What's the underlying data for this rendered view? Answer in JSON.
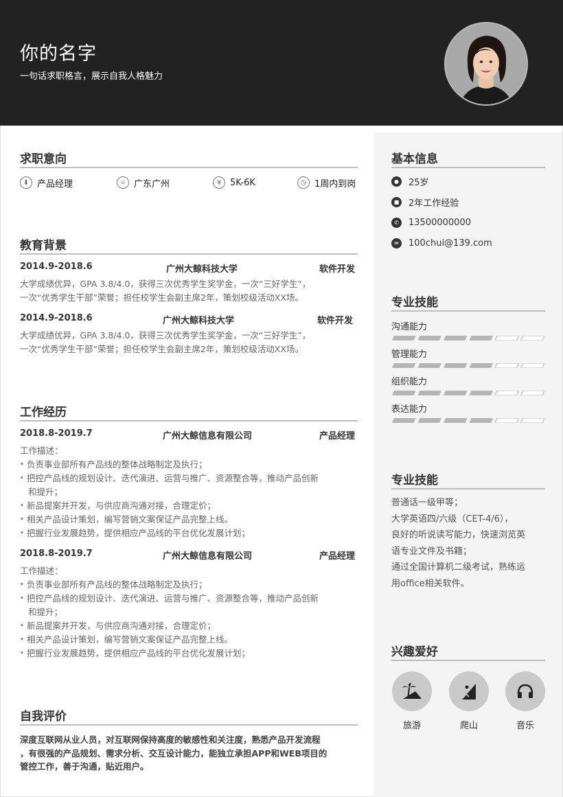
{
  "header": {
    "name": "你的名字",
    "slogan": "一句话求职格言，展示自我人格魅力"
  },
  "intent": {
    "title": "求职意向",
    "items": [
      {
        "icon": "briefcase-icon",
        "text": "产品经理"
      },
      {
        "icon": "location-icon",
        "text": "广东广州"
      },
      {
        "icon": "yen-icon",
        "text": "5K-6K"
      },
      {
        "icon": "clock-icon",
        "text": "1周内到岗"
      }
    ]
  },
  "education": {
    "title": "教育背景",
    "entries": [
      {
        "date": "2014.9-2018.6",
        "school": "广州大鲸科技大学",
        "major": "软件开发",
        "line1": "大学成绩优异，GPA 3.8/4.0，获得三次优秀学生奖学金，一次“三好学生”，",
        "line2": "一次“优秀学生干部”荣誉；担任校学生会副主席2年，策划校级活动XX场。"
      },
      {
        "date": "2014.9-2018.6",
        "school": "广州大鲸科技大学",
        "major": "软件开发",
        "line1": "大学成绩优异，GPA 3.8/4.0，获得三次优秀学生奖学金，一次“三好学生”，",
        "line2": "一次“优秀学生干部”荣誉；担任校学生会副主席2年，策划校级活动XX场。"
      }
    ]
  },
  "work": {
    "title": "工作经历",
    "entries": [
      {
        "date": "2018.8-2019.7",
        "company": "广州大鲸信息有限公司",
        "role": "产品经理",
        "desc_label": "工作描述：",
        "bullets": [
          "负责事业部所有产品线的整体战略制定及执行；",
          "把控产品线的规划设计、迭代演进、运营与推广、资源整合等，推动产品创新",
          "和提升；",
          "新品提案并开发，与供应商沟通对接，合理定价；",
          "相关产品设计策划，编写营销文案保证产品完整上线。",
          "把握行业发展趋势，提供相应产品线的平台优化发展计划；"
        ]
      },
      {
        "date": "2018.8-2019.7",
        "company": "广州大鲸信息有限公司",
        "role": "产品经理",
        "desc_label": "工作描述：",
        "bullets": [
          "负责事业部所有产品线的整体战略制定及执行；",
          "把控产品线的规划设计、迭代演进、运营与推广、资源整合等，推动产品创新",
          "和提升；",
          "新品提案并开发，与供应商沟通对接，合理定价；",
          "相关产品设计策划，编写营销文案保证产品完整上线。",
          "把握行业发展趋势，提供相应产品线的平台优化发展计划；"
        ]
      }
    ]
  },
  "self_eval": {
    "title": "自我评价",
    "lines": [
      "深度互联网从业人员，对互联网保持高度的敏感性和关注度，熟悉产品开发流程",
      "，有很强的产品规划、需求分析、交互设计能力，能独立承担APP和WEB项目的",
      "管控工作，善于沟通，贴近用户。"
    ]
  },
  "basic_info": {
    "title": "基本信息",
    "items": [
      {
        "icon": "age-icon",
        "text": "25岁"
      },
      {
        "icon": "experience-icon",
        "text": "2年工作经验"
      },
      {
        "icon": "phone-icon",
        "text": "13500000000"
      },
      {
        "icon": "email-icon",
        "text": "100chui@139.com"
      }
    ]
  },
  "skills": {
    "title": "专业技能",
    "items": [
      {
        "name": "沟通能力",
        "level": 0.67
      },
      {
        "name": "管理能力",
        "level": 0.67
      },
      {
        "name": "组织能力",
        "level": 0.67
      },
      {
        "name": "表达能力",
        "level": 0.67
      }
    ]
  },
  "skills2": {
    "title": "专业技能",
    "lines": [
      "普通话一级甲等；",
      "大学英语四/六级（CET-4/6），",
      "良好的听说读写能力，快速浏览英",
      "语专业文件及书籍；",
      "通过全国计算机二级考试，熟练运",
      "用office相关软件。"
    ]
  },
  "hobbies": {
    "title": "兴趣爱好",
    "items": [
      {
        "icon": "beach-icon",
        "label": "旅游"
      },
      {
        "icon": "climbing-icon",
        "label": "爬山"
      },
      {
        "icon": "headphones-icon",
        "label": "音乐"
      }
    ]
  }
}
